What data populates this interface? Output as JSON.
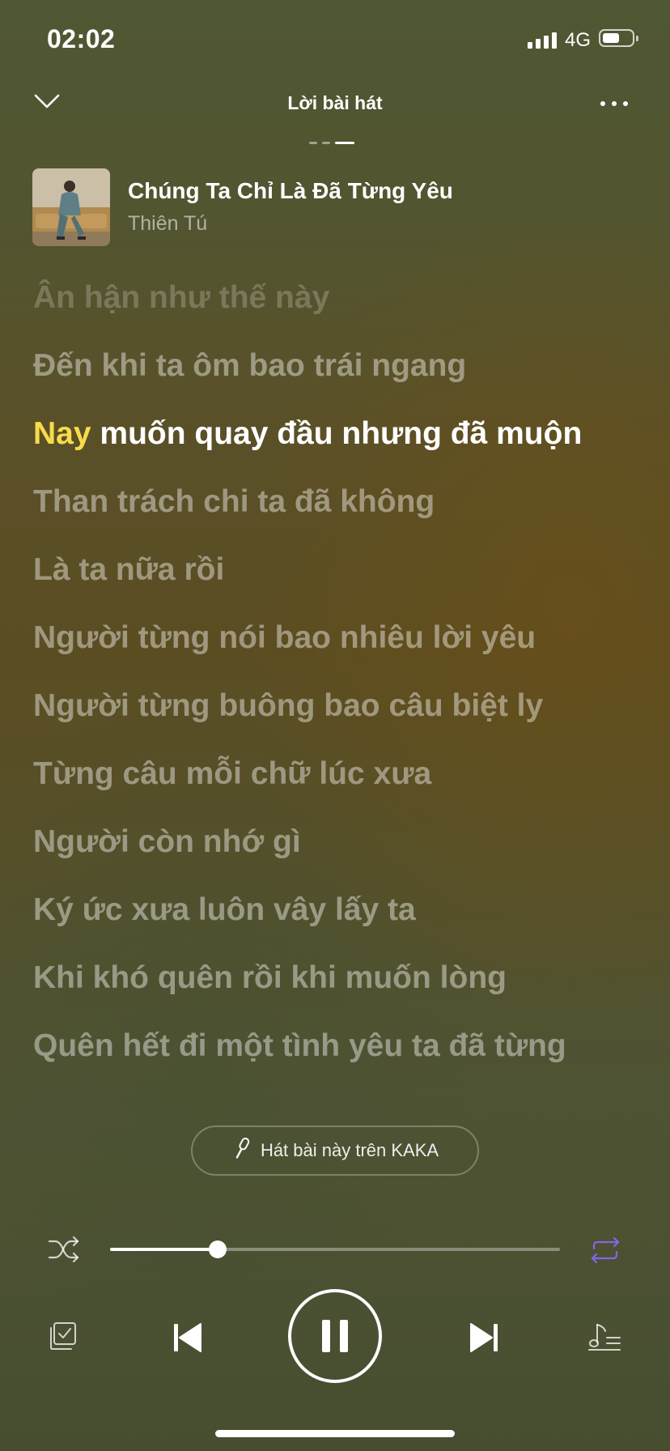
{
  "status_bar": {
    "time": "02:02",
    "network": "4G",
    "battery_level": 0.55
  },
  "header": {
    "title": "Lời bài hát",
    "page_count": 3,
    "active_page": 3
  },
  "song": {
    "title": "Chúng Ta Chỉ Là Đã Từng Yêu",
    "artist": "Thiên Tú"
  },
  "lyrics": {
    "lines": [
      "Ân hận như thế này",
      "Đến khi ta ôm bao trái ngang",
      "muốn quay đầu nhưng đã muộn",
      "Than trách chi ta đã không",
      "Là ta nữa rồi",
      "Người từng nói bao nhiêu lời yêu",
      "Người từng buông bao câu biệt ly",
      "Từng câu mỗi chữ lúc xưa",
      "Người còn nhớ gì",
      "Ký ức xưa luôn vây lấy ta",
      "Khi khó quên rồi khi muốn lòng",
      "Quên hết đi một tình yêu ta đã từng"
    ],
    "active_line_index": 2,
    "active_highlight": "Nay",
    "highlight_color": "#f7dc49"
  },
  "karaoke_button": {
    "label": "Hát bài này trên KAKA"
  },
  "player": {
    "progress": 0.24,
    "shuffle_on": false,
    "repeat_on": true,
    "repeat_color": "#8a63e8",
    "state": "playing"
  },
  "icons": {
    "collapse": "chevron-down-icon",
    "more": "more-dots-icon",
    "karaoke": "microphone-icon",
    "shuffle": "shuffle-icon",
    "repeat": "repeat-icon",
    "playlist": "playlist-check-icon",
    "prev": "skip-previous-icon",
    "pause": "pause-icon",
    "next": "skip-next-icon",
    "music_list": "music-list-icon"
  }
}
